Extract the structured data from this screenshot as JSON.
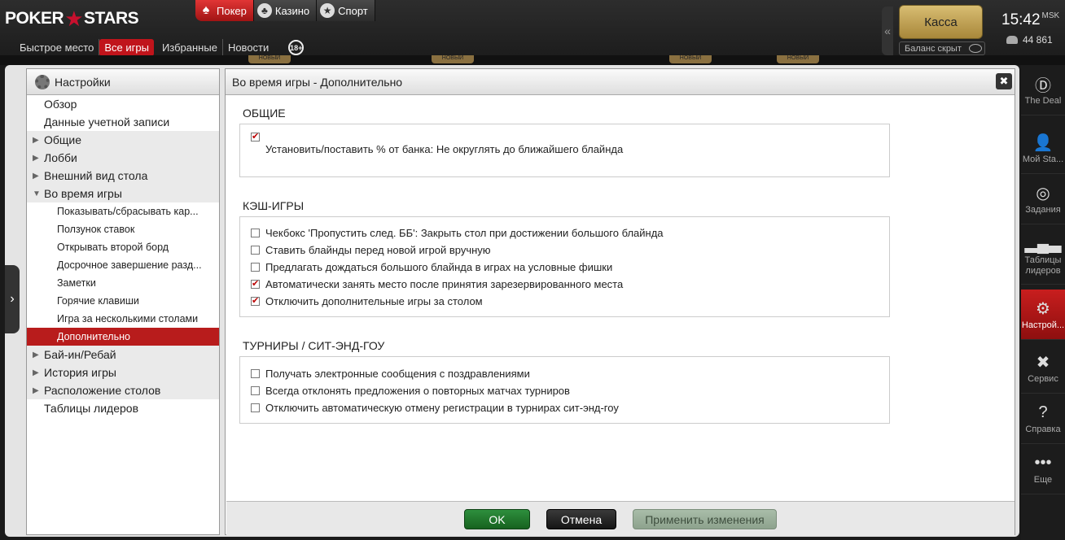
{
  "brand": {
    "left": "POKER",
    "right": "STARS"
  },
  "top_tabs": [
    {
      "label": "Покер",
      "icon": "spade-icon"
    },
    {
      "label": "Казино",
      "icon": "cards-icon"
    },
    {
      "label": "Спорт",
      "icon": "ball-icon"
    }
  ],
  "subnav": [
    "Быстрое место",
    "Все игры",
    "Избранные",
    "Новости"
  ],
  "age_badge": "18+",
  "cashier_label": "Касса",
  "balance_label": "Баланс скрыт",
  "clock": {
    "time": "15:42",
    "zone": "MSK"
  },
  "players_online": "44 861",
  "new_badge": "НОВЫЙ",
  "settings_title": "Настройки",
  "tree": [
    {
      "label": "Обзор",
      "level": 0
    },
    {
      "label": "Данные учетной записи",
      "level": 0
    },
    {
      "label": "Общие",
      "level": 0,
      "arrow": "▶"
    },
    {
      "label": "Лобби",
      "level": 0,
      "arrow": "▶"
    },
    {
      "label": "Внешний вид стола",
      "level": 0,
      "arrow": "▶"
    },
    {
      "label": "Во время игры",
      "level": 0,
      "arrow": "▼"
    },
    {
      "label": "Показывать/сбрасывать кар...",
      "level": 1
    },
    {
      "label": "Ползунок ставок",
      "level": 1
    },
    {
      "label": "Открывать второй борд",
      "level": 1
    },
    {
      "label": "Досрочное завершение разд...",
      "level": 1
    },
    {
      "label": "Заметки",
      "level": 1
    },
    {
      "label": "Горячие клавиши",
      "level": 1
    },
    {
      "label": "Игра за несколькими столами",
      "level": 1
    },
    {
      "label": "Дополнительно",
      "level": 1,
      "selected": true
    },
    {
      "label": "Бай-ин/Ребай",
      "level": 0,
      "arrow": "▶"
    },
    {
      "label": "История игры",
      "level": 0,
      "arrow": "▶"
    },
    {
      "label": "Расположение столов",
      "level": 0,
      "arrow": "▶"
    },
    {
      "label": "Таблицы лидеров",
      "level": 0
    }
  ],
  "panel_title": "Во время игры - Дополнительно",
  "close_glyph": "✖",
  "sections": {
    "general": {
      "title": "ОБЩИЕ",
      "items": [
        {
          "label": "Установить/поставить % от банка: Не округлять до ближайшего блайнда",
          "checked": true
        }
      ]
    },
    "cash": {
      "title": "КЭШ-ИГРЫ",
      "items": [
        {
          "label": "Чекбокс 'Пропустить след. ББ': Закрыть стол при достижении большого блайнда",
          "checked": false
        },
        {
          "label": "Ставить блайнды перед новой игрой вручную",
          "checked": false
        },
        {
          "label": "Предлагать дождаться большого блайнда в играх на условные фишки",
          "checked": false
        },
        {
          "label": "Автоматически занять место после принятия зарезервированного места",
          "checked": true
        },
        {
          "label": "Отключить дополнительные игры за столом",
          "checked": true
        }
      ]
    },
    "tourney": {
      "title": "ТУРНИРЫ / СИТ-ЭНД-ГОУ",
      "items": [
        {
          "label": "Получать электронные сообщения с поздравлениями",
          "checked": false
        },
        {
          "label": "Всегда отклонять предложения о повторных матчах турниров",
          "checked": false
        },
        {
          "label": "Отключить автоматическую отмену регистрации в турнирах сит-энд-гоу",
          "checked": false
        }
      ]
    }
  },
  "buttons": {
    "ok": "OK",
    "cancel": "Отмена",
    "apply": "Применить изменения"
  },
  "rightbar": [
    {
      "label": "The Deal",
      "icon": "deal-icon",
      "glyph": "Ⓓ"
    },
    {
      "label": "Мой Sta...",
      "icon": "user-icon",
      "glyph": "👤"
    },
    {
      "label": "Задания",
      "icon": "target-icon",
      "glyph": "◎"
    },
    {
      "label": "Таблицы лидеров",
      "icon": "podium-icon",
      "glyph": "▂▄▃"
    },
    {
      "label": "Настрой...",
      "icon": "gear-icon",
      "glyph": "⚙",
      "active": true
    },
    {
      "label": "Сервис",
      "icon": "tools-icon",
      "glyph": "✖"
    },
    {
      "label": "Справка",
      "icon": "help-icon",
      "glyph": "?"
    },
    {
      "label": "Еще",
      "icon": "more-icon",
      "glyph": "•••"
    }
  ],
  "colors": {
    "accent": "#c0141b",
    "ok": "#2e8f3d",
    "gold": "#c9ab5c"
  }
}
